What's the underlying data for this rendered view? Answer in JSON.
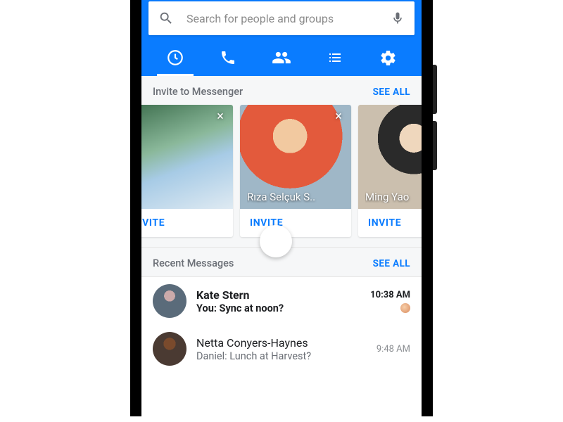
{
  "search": {
    "placeholder": "Search for people and groups"
  },
  "tabs": {
    "items": [
      "recent",
      "calls",
      "people",
      "lists",
      "settings"
    ],
    "active": 0
  },
  "invite": {
    "title": "Invite to Messenger",
    "see_all": "SEE ALL",
    "action_label": "INVITE",
    "cards": [
      {
        "name": ""
      },
      {
        "name": "Rıza Selçuk S.."
      },
      {
        "name": "Ming Yao"
      },
      {
        "name": ""
      }
    ]
  },
  "recent": {
    "title": "Recent Messages",
    "see_all": "SEE ALL",
    "messages": [
      {
        "name": "Kate Stern",
        "preview": "You: Sync at noon?",
        "time": "10:38 AM",
        "unread": true,
        "delivered_avatar": true
      },
      {
        "name": "Netta Conyers-Haynes",
        "preview": "Daniel: Lunch at Harvest?",
        "time": "9:48 AM",
        "unread": false,
        "delivered_avatar": false
      }
    ]
  }
}
